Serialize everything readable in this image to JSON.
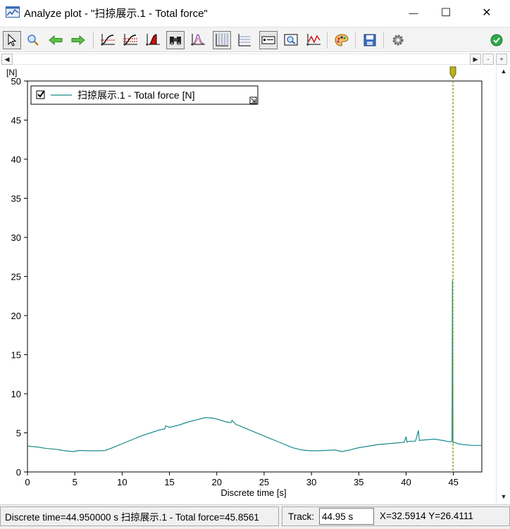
{
  "window": {
    "title": "Analyze plot - \"扫掠展示.1 - Total force\"",
    "minimize_glyph": "—",
    "maximize_glyph": "☐",
    "close_glyph": "✕"
  },
  "toolbar": {
    "items": [
      {
        "name": "select-icon"
      },
      {
        "name": "zoom-icon"
      },
      {
        "name": "back-arrow-icon"
      },
      {
        "name": "forward-arrow-icon"
      },
      {
        "name": "curve-fit-icon"
      },
      {
        "name": "curve-compare-icon"
      },
      {
        "name": "area-fill-icon"
      },
      {
        "name": "binoculars-icon"
      },
      {
        "name": "peak-icon"
      },
      {
        "name": "vertical-grid-icon"
      },
      {
        "name": "horizontal-grid-icon"
      },
      {
        "name": "legend-icon"
      },
      {
        "name": "zoom-window-icon"
      },
      {
        "name": "trend-icon"
      },
      {
        "name": "palette-icon"
      },
      {
        "name": "save-icon"
      },
      {
        "name": "settings-icon"
      },
      {
        "name": "ok-check-icon"
      }
    ]
  },
  "scroll": {
    "left": "◀",
    "right": "▶",
    "minus": "-",
    "plus": "+",
    "up": "▲",
    "down": "▼"
  },
  "chart_data": {
    "type": "line",
    "ylabel": "[N]",
    "xlabel": "Discrete time [s]",
    "xlim": [
      0,
      48
    ],
    "ylim": [
      0,
      50
    ],
    "xticks": [
      0,
      5,
      10,
      15,
      20,
      25,
      30,
      35,
      40,
      45
    ],
    "yticks": [
      0,
      5,
      10,
      15,
      20,
      25,
      30,
      35,
      40,
      45,
      50
    ],
    "series": [
      {
        "name": "扫掠展示.1 - Total force [N]",
        "color": "#1a8a8a",
        "x": [
          0,
          1,
          2,
          3,
          4,
          4.8,
          5.5,
          6.5,
          7.5,
          8.2,
          9,
          10,
          11,
          12,
          13,
          14,
          14.5,
          14.6,
          15,
          16,
          17,
          18,
          18.8,
          19.5,
          20.2,
          21,
          21.5,
          21.6,
          22,
          23,
          24,
          25,
          26,
          27,
          28,
          29,
          30,
          30.5,
          31.5,
          32.5,
          33.2,
          34,
          35,
          36,
          37,
          38,
          39,
          39.8,
          40,
          40.1,
          40.2,
          41,
          41.3,
          41.4,
          41.5,
          42,
          43,
          44,
          44.6,
          44.85,
          44.9,
          44.95,
          45,
          45.1,
          45.5,
          46,
          47,
          48
        ],
        "y": [
          3.3,
          3.2,
          3.0,
          2.9,
          2.7,
          2.6,
          2.75,
          2.7,
          2.7,
          2.75,
          3.1,
          3.6,
          4.1,
          4.6,
          5.0,
          5.4,
          5.5,
          5.9,
          5.7,
          6.0,
          6.4,
          6.7,
          6.95,
          6.9,
          6.7,
          6.4,
          6.3,
          6.6,
          6.1,
          5.6,
          5.1,
          4.6,
          4.1,
          3.6,
          3.1,
          2.8,
          2.7,
          2.7,
          2.75,
          2.8,
          2.6,
          2.8,
          3.1,
          3.3,
          3.5,
          3.6,
          3.7,
          3.8,
          4.5,
          3.8,
          3.9,
          3.95,
          5.3,
          4.0,
          4.05,
          4.1,
          4.2,
          4.0,
          3.85,
          3.9,
          24.5,
          3.8,
          3.7,
          3.8,
          3.6,
          3.5,
          3.4,
          3.4
        ]
      }
    ],
    "cursor_x": 44.95,
    "legend_position": "top-left",
    "grid": false
  },
  "status": {
    "info": "Discrete time=44.950000 s 扫掠展示.1 - Total force=45.8561",
    "track_label": "Track:",
    "track_value": "44.95 s",
    "coords": "X=32.5914  Y=26.4111"
  }
}
